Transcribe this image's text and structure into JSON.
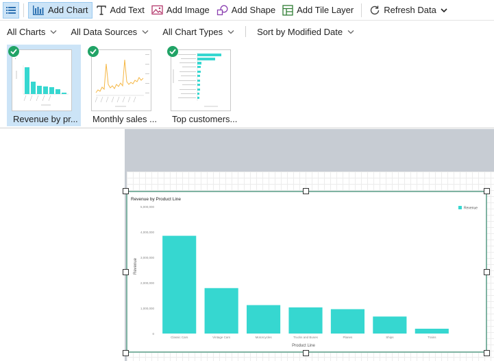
{
  "toolbar": {
    "add_chart": "Add Chart",
    "add_text": "Add Text",
    "add_image": "Add Image",
    "add_shape": "Add Shape",
    "add_tile_layer": "Add Tile Layer",
    "refresh_data": "Refresh Data"
  },
  "filters": {
    "charts": "All Charts",
    "data_sources": "All Data Sources",
    "chart_types": "All Chart Types",
    "sort": "Sort by Modified Date"
  },
  "thumbnails": [
    {
      "label": "Revenue by pr...",
      "selected": true
    },
    {
      "label": "Monthly sales ...",
      "selected": false
    },
    {
      "label": "Top customers...",
      "selected": false
    }
  ],
  "colors": {
    "accent": "#36d7d0",
    "selection": "#cce4f7",
    "check": "#21a366"
  },
  "chart_data": {
    "type": "bar",
    "title": "Revenue by Product Line",
    "xlabel": "Product Line",
    "ylabel": "Revenue",
    "categories": [
      "Classic Cars",
      "Vintage Cars",
      "Motorcycles",
      "Trucks and Buses",
      "Planes",
      "Ships",
      "Trains"
    ],
    "series": [
      {
        "name": "Revenue",
        "values": [
          3850000,
          1790000,
          1120000,
          1030000,
          960000,
          670000,
          190000
        ]
      }
    ],
    "ylim": [
      0,
      5000000
    ],
    "yticks": [
      "0",
      "1,000,000",
      "2,000,000",
      "3,000,000",
      "4,000,000",
      "5,000,000"
    ],
    "legend": "top-right",
    "grid": false
  }
}
